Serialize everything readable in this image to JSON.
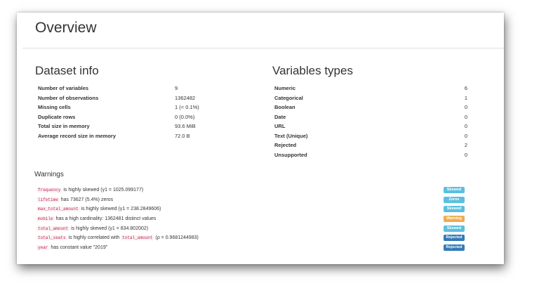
{
  "overview_title": "Overview",
  "dataset_info": {
    "title": "Dataset info",
    "rows": [
      {
        "label": "Number of variables",
        "value": "9"
      },
      {
        "label": "Number of observations",
        "value": "1362482"
      },
      {
        "label": "Missing cells",
        "value": "1 (< 0.1%)"
      },
      {
        "label": "Duplicate rows",
        "value": "0 (0.0%)"
      },
      {
        "label": "Total size in memory",
        "value": "93.6 MiB"
      },
      {
        "label": "Average record size in memory",
        "value": "72.0 B"
      }
    ]
  },
  "variables_types": {
    "title": "Variables types",
    "rows": [
      {
        "label": "Numeric",
        "value": "6"
      },
      {
        "label": "Categorical",
        "value": "1"
      },
      {
        "label": "Boolean",
        "value": "0"
      },
      {
        "label": "Date",
        "value": "0"
      },
      {
        "label": "URL",
        "value": "0"
      },
      {
        "label": "Text (Unique)",
        "value": "0"
      },
      {
        "label": "Rejected",
        "value": "2"
      },
      {
        "label": "Unsupported",
        "value": "0"
      }
    ]
  },
  "warnings": {
    "title": "Warnings",
    "items": [
      {
        "code": "frequency",
        "text": " is highly skewed (γ1 = 1025.099177)",
        "badge": "Skewed",
        "badge_color": "#5bc0de"
      },
      {
        "code": "lifetime",
        "text": " has 73627 (5.4%) zeros",
        "badge": "Zeros",
        "badge_color": "#5bc0de"
      },
      {
        "code": "max_total_amount",
        "text": " is highly skewed (γ1 = 238.2849606)",
        "badge": "Skewed",
        "badge_color": "#5bc0de"
      },
      {
        "code": "mobile",
        "text": " has a high cardinality: 1362481 distinct values",
        "badge": "Warning",
        "badge_color": "#f0ad4e"
      },
      {
        "code": "total_amount",
        "text": " is highly skewed (γ1 = 834.802002)",
        "badge": "Skewed",
        "badge_color": "#5bc0de"
      },
      {
        "code": "total_seats",
        "text": " is highly correlated with ",
        "code2": "total_amount",
        "text2": " (ρ = 0.9681244983)",
        "badge": "Rejected",
        "badge_color": "#337ab7"
      },
      {
        "code": "year",
        "text": " has constant value \"2019\"",
        "badge": "Rejected",
        "badge_color": "#337ab7"
      }
    ]
  }
}
